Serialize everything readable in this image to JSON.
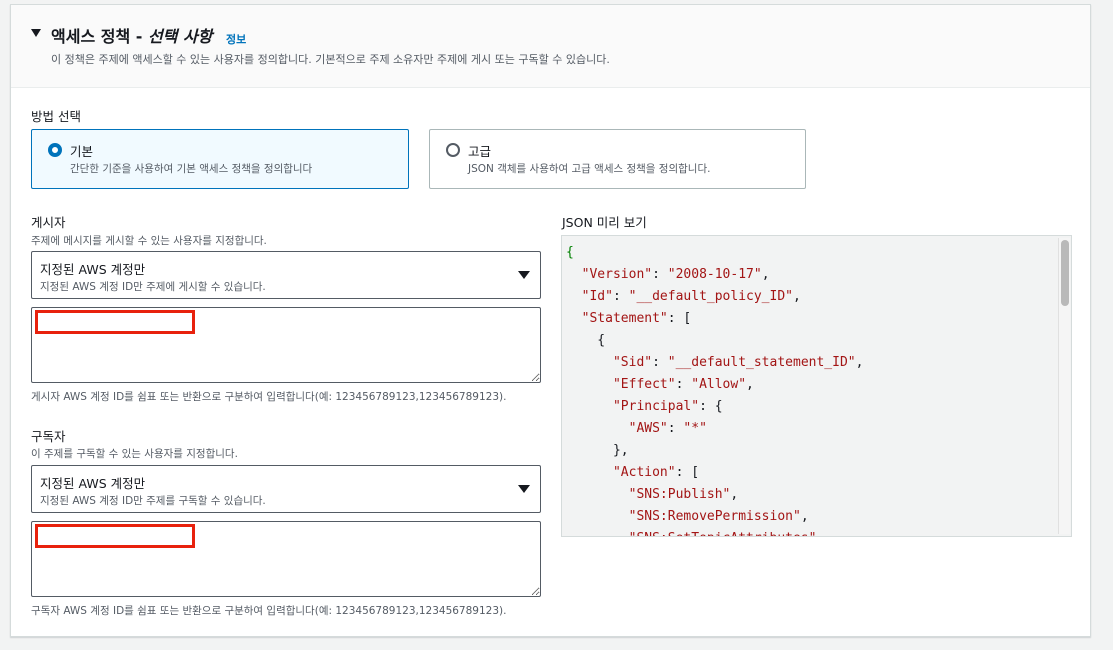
{
  "header": {
    "title_prefix": "액세스 정책 - ",
    "title_italic": "선택 사항",
    "info_link": "정보",
    "description": "이 정책은 주제에 액세스할 수 있는 사용자를 정의합니다. 기본적으로 주제 소유자만 주제에 게시 또는 구독할 수 있습니다."
  },
  "method": {
    "label": "방법 선택",
    "options": [
      {
        "title": "기본",
        "description": "간단한 기준을 사용하여 기본 액세스 정책을 정의합니다",
        "selected": true
      },
      {
        "title": "고급",
        "description": "JSON 객체를 사용하여 고급 액세스 정책을 정의합니다.",
        "selected": false
      }
    ]
  },
  "publishers": {
    "label": "게시자",
    "description": "주제에 메시지를 게시할 수 있는 사용자를 지정합니다.",
    "select_value": "지정된 AWS 계정만",
    "select_description": "지정된 AWS 계정 ID만 주제에 게시할 수 있습니다.",
    "input_value": "",
    "hint": "게시자 AWS 계정 ID를 쉼표 또는 반환으로 구분하여 입력합니다(예: 123456789123,123456789123)."
  },
  "subscribers": {
    "label": "구독자",
    "description": "이 주제를 구독할 수 있는 사용자를 지정합니다.",
    "select_value": "지정된 AWS 계정만",
    "select_description": "지정된 AWS 계정 ID만 주제를 구독할 수 있습니다.",
    "input_value": "",
    "hint": "구독자 AWS 계정 ID를 쉼표 또는 반환으로 구분하여 입력합니다(예: 123456789123,123456789123)."
  },
  "json_preview": {
    "label": "JSON 미리 보기",
    "lines": [
      "{",
      "  \"Version\": \"2008-10-17\",",
      "  \"Id\": \"__default_policy_ID\",",
      "  \"Statement\": [",
      "    {",
      "      \"Sid\": \"__default_statement_ID\",",
      "      \"Effect\": \"Allow\",",
      "      \"Principal\": {",
      "        \"AWS\": \"*\"",
      "      },",
      "      \"Action\": [",
      "        \"SNS:Publish\",",
      "        \"SNS:RemovePermission\",",
      "        \"SNS:SetTopicAttributes\","
    ]
  },
  "colors": {
    "accent": "#0073bb",
    "redaction": "#e8210d",
    "json_key": "#a31515",
    "json_brace": "#008000"
  }
}
